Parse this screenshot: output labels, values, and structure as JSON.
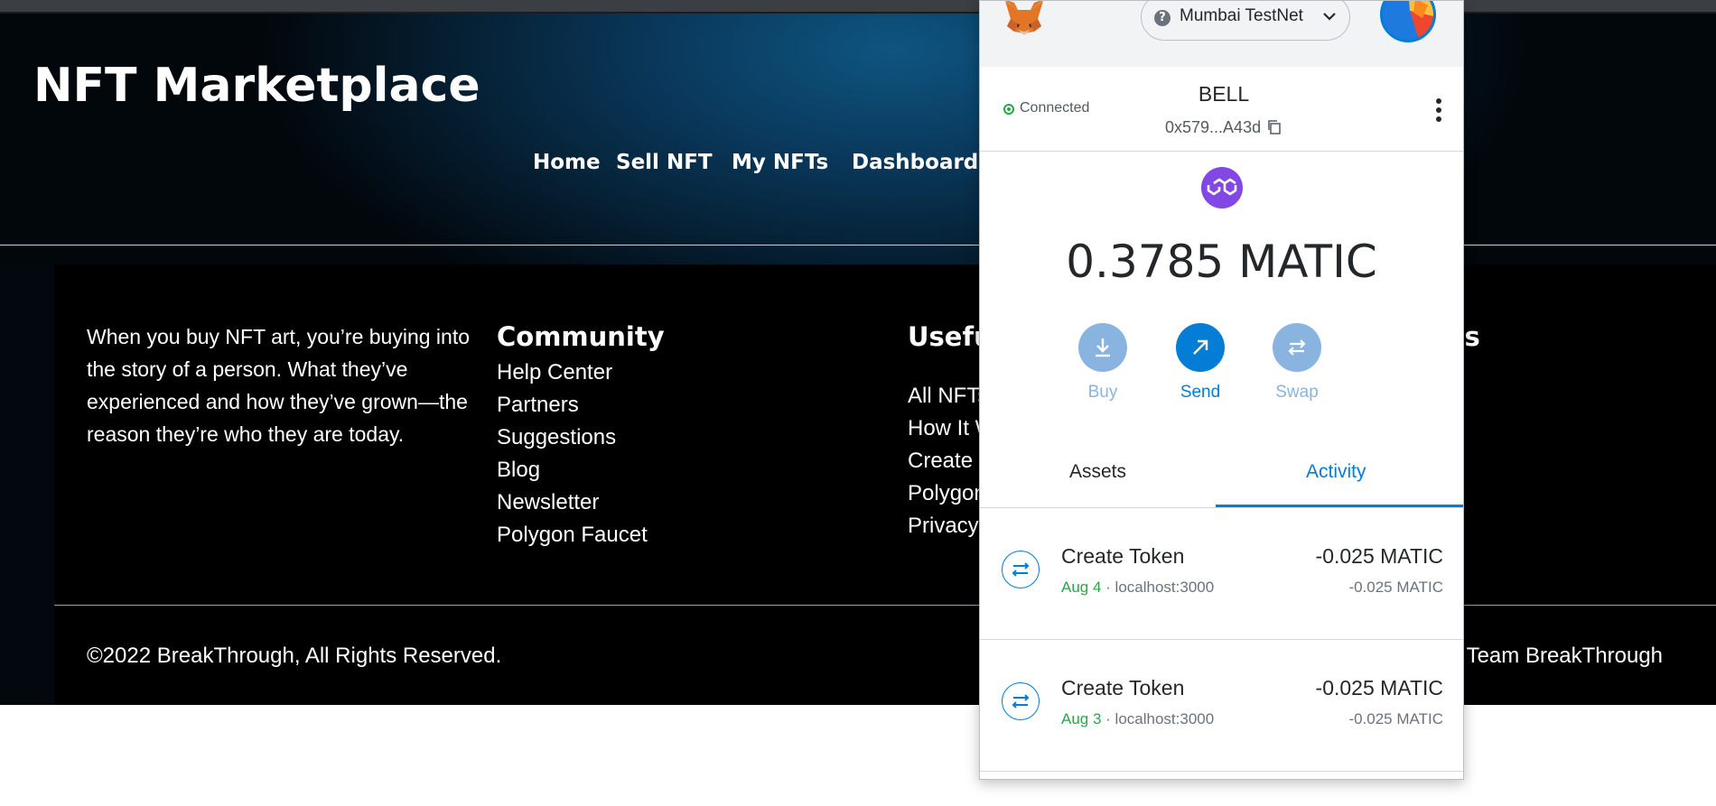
{
  "site": {
    "title": "NFT Marketplace",
    "nav": [
      "Home",
      "Sell NFT",
      "My NFTs",
      "Dashboard"
    ]
  },
  "footer": {
    "about": "When you buy NFT art, you’re buying into the story of a person. What they’ve experienced and how they’ve grown—the reason they’re who they are today.",
    "community_title": "Community",
    "community_links": [
      "Help Center",
      "Partners",
      "Suggestions",
      "Blog",
      "Newsletter",
      "Polygon Faucet"
    ],
    "useful_title": "Usefu",
    "useful_links": [
      "All NFTs",
      "How It W",
      "Create",
      "Polygon",
      "Privacy"
    ],
    "contact_title_partial": "Us",
    "copyright": "©2022 BreakThrough, All Rights Reserved.",
    "credit_partial": "by Team BreakThrough"
  },
  "wallet": {
    "network": "Mumbai TestNet",
    "connection_status": "Connected",
    "account_name": "BELL",
    "account_address": "0x579...A43d",
    "balance": "0.3785 MATIC",
    "actions": [
      "Buy",
      "Send",
      "Swap"
    ],
    "tabs": [
      "Assets",
      "Activity"
    ],
    "active_tab": "Activity",
    "colors": {
      "accent": "#037dd6",
      "disabled_accent": "#8ab4e0",
      "success": "#28a745",
      "matic": "#8247e5"
    },
    "transactions": [
      {
        "title": "Create Token",
        "date": "Aug 4",
        "origin": " · localhost:3000",
        "amount": "-0.025 MATIC",
        "amount_secondary": "-0.025 MATIC"
      },
      {
        "title": "Create Token",
        "date": "Aug 3",
        "origin": " · localhost:3000",
        "amount": "-0.025 MATIC",
        "amount_secondary": "-0.025 MATIC"
      }
    ]
  }
}
